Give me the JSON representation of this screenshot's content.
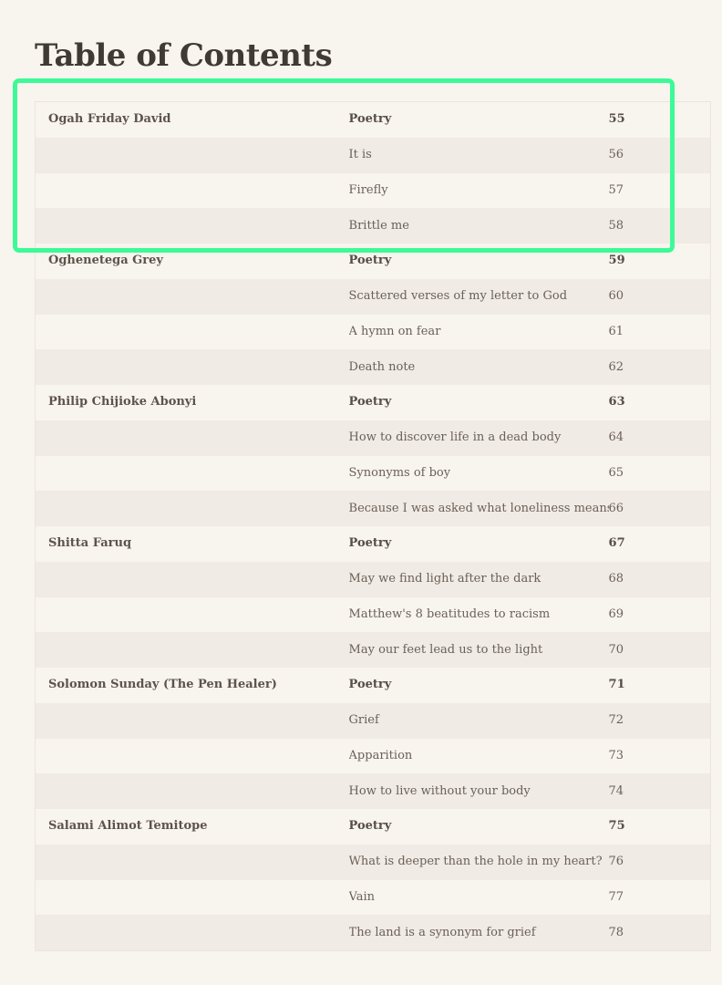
{
  "page": {
    "title": "Table of Contents"
  },
  "highlight": {
    "color": "#3dfa98"
  },
  "toc": {
    "rows": [
      {
        "author": "Ogah Friday David",
        "title": "Poetry",
        "page": "55",
        "section": true
      },
      {
        "author": "",
        "title": "It is",
        "page": "56",
        "section": false
      },
      {
        "author": "",
        "title": "Firefly",
        "page": "57",
        "section": false
      },
      {
        "author": "",
        "title": "Brittle me",
        "page": "58",
        "section": false
      },
      {
        "author": "Oghenetega Grey",
        "title": "Poetry",
        "page": "59",
        "section": true
      },
      {
        "author": "",
        "title": "Scattered verses of my letter to God",
        "page": "60",
        "section": false
      },
      {
        "author": "",
        "title": "A hymn on fear",
        "page": "61",
        "section": false
      },
      {
        "author": "",
        "title": "Death note",
        "page": "62",
        "section": false
      },
      {
        "author": "Philip Chijioke Abonyi",
        "title": "Poetry",
        "page": "63",
        "section": true
      },
      {
        "author": "",
        "title": "How to discover life in a dead body",
        "page": "64",
        "section": false
      },
      {
        "author": "",
        "title": "Synonyms of boy",
        "page": "65",
        "section": false
      },
      {
        "author": "",
        "title": "Because I was asked what loneliness means",
        "page": "66",
        "section": false
      },
      {
        "author": "Shitta Faruq",
        "title": "Poetry",
        "page": "67",
        "section": true
      },
      {
        "author": "",
        "title": "May we find light after the dark",
        "page": "68",
        "section": false
      },
      {
        "author": "",
        "title": "Matthew's 8 beatitudes to racism",
        "page": "69",
        "section": false
      },
      {
        "author": "",
        "title": "May our feet lead us to the light",
        "page": "70",
        "section": false
      },
      {
        "author": "Solomon Sunday (The Pen Healer)",
        "title": "Poetry",
        "page": "71",
        "section": true
      },
      {
        "author": "",
        "title": "Grief",
        "page": "72",
        "section": false
      },
      {
        "author": "",
        "title": "Apparition",
        "page": "73",
        "section": false
      },
      {
        "author": "",
        "title": "How to live without your body",
        "page": "74",
        "section": false
      },
      {
        "author": "Salami Alimot Temitope",
        "title": "Poetry",
        "page": "75",
        "section": true
      },
      {
        "author": "",
        "title": "What is deeper than the hole in my heart?",
        "page": "76",
        "section": false
      },
      {
        "author": "",
        "title": "Vain",
        "page": "77",
        "section": false
      },
      {
        "author": "",
        "title": "The land is a synonym for grief",
        "page": "78",
        "section": false
      }
    ]
  }
}
